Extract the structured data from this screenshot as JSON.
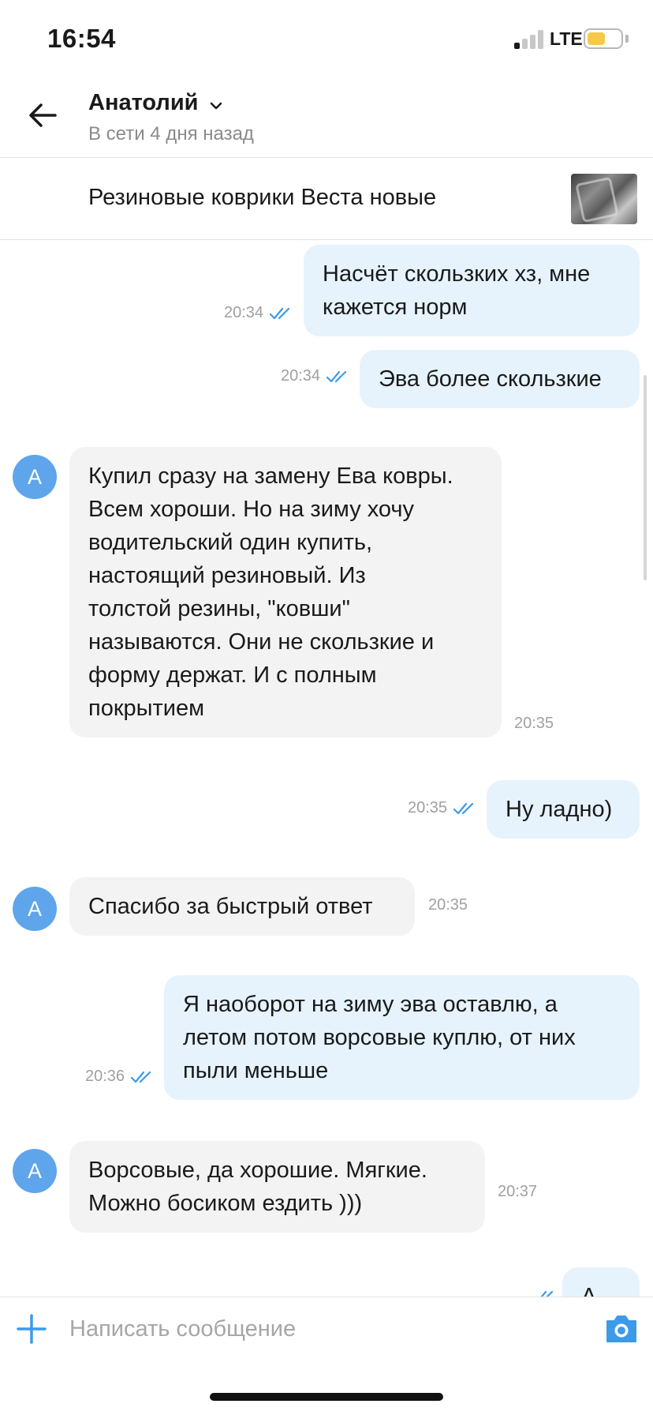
{
  "status_bar": {
    "time": "16:54",
    "network": "LTE",
    "signal_bars_active": 1,
    "signal_bars_total": 4,
    "battery_color": "#f7c948"
  },
  "header": {
    "back_icon": "arrow-left-icon",
    "contact_name": "Анатолий",
    "contact_status": "В сети 4 дня назад"
  },
  "listing": {
    "title": "Резиновые коврики Веста новые",
    "thumbnail": "rubber-mat-photo"
  },
  "messages": [
    {
      "direction": "out",
      "lines": [
        "Насчёт скользких хз, мне",
        "кажется норм"
      ],
      "time": "20:34",
      "read": true
    },
    {
      "direction": "out",
      "lines": [
        "Эва более скользкие"
      ],
      "time": "20:34",
      "read": true
    },
    {
      "direction": "in",
      "avatar": "А",
      "lines": [
        "Купил сразу на замену Ева ковры.",
        "Всем хороши. Но на зиму хочу",
        "водительский один купить,",
        "настоящий резиновый. Из",
        "толстой резины, \"ковши\"",
        "называются. Они не скользкие и",
        "форму держат. И с полным",
        "покрытием"
      ],
      "time": "20:35"
    },
    {
      "direction": "out",
      "lines": [
        "Ну ладно)"
      ],
      "time": "20:35",
      "read": true
    },
    {
      "direction": "in",
      "avatar": "А",
      "lines": [
        "Спасибо за быстрый ответ"
      ],
      "time": "20:35"
    },
    {
      "direction": "out",
      "lines": [
        "Я наоборот на зиму эва оставлю, а",
        "летом потом ворсовые куплю, от них",
        "пыли меньше"
      ],
      "time": "20:36",
      "read": true
    },
    {
      "direction": "in",
      "avatar": "А",
      "lines": [
        "Ворсовые, да хорошие. Мягкие.",
        "Можно босиком ездить )))"
      ],
      "time": "20:37"
    },
    {
      "direction": "out",
      "lines": [
        "А"
      ],
      "partial": true
    }
  ],
  "input": {
    "placeholder": "Написать сообщение",
    "value": "",
    "attach_icon": "plus-icon",
    "camera_icon": "camera-icon"
  },
  "colors": {
    "accent": "#3d9ae8",
    "outgoing_bubble": "#e6f3fd",
    "incoming_bubble": "#f3f3f3",
    "avatar_bg": "#5ea5ec"
  }
}
